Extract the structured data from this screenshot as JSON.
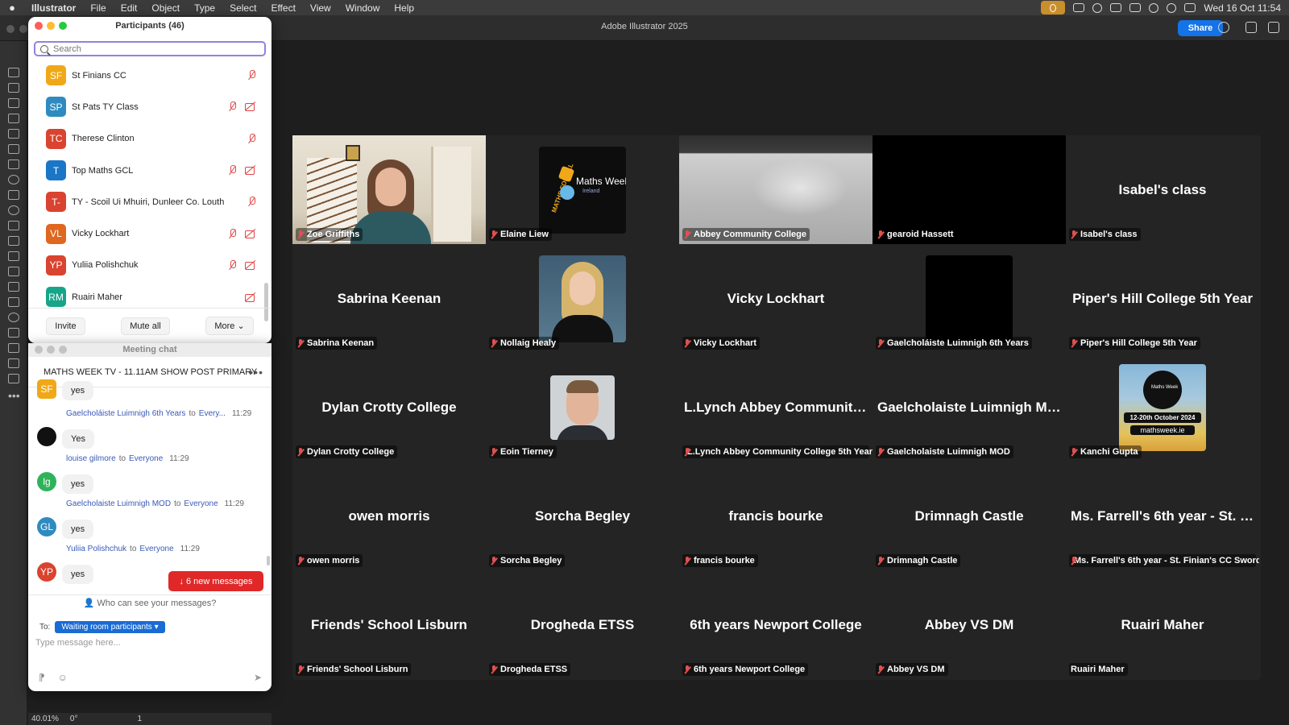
{
  "menubar": {
    "app": "Illustrator",
    "items": [
      "File",
      "Edit",
      "Object",
      "Type",
      "Select",
      "Effect",
      "View",
      "Window",
      "Help"
    ],
    "datetime": "Wed 16 Oct  11:54"
  },
  "app_window": {
    "title": "Adobe Illustrator 2025",
    "share": "Share"
  },
  "statusbar": {
    "zoom": "40.01%",
    "rotation": "0°",
    "artboard": "1"
  },
  "participants": {
    "title": "Participants (46)",
    "search_placeholder": "Search",
    "rows": [
      {
        "initials": "SF",
        "name": "St Finians CC",
        "color": "#f0a818",
        "mic_muted": true,
        "cam_off": false
      },
      {
        "initials": "SP",
        "name": "St Pats TY Class",
        "color": "#2e8bc0",
        "mic_muted": true,
        "cam_off": true
      },
      {
        "initials": "TC",
        "name": "Therese Clinton",
        "color": "#d9432f",
        "mic_muted": true,
        "cam_off": false
      },
      {
        "initials": "T",
        "name": "Top Maths GCL",
        "color": "#1a76c6",
        "mic_muted": true,
        "cam_off": true
      },
      {
        "initials": "T-",
        "name": "TY - Scoil Ui Mhuiri, Dunleer Co. Louth",
        "color": "#d9432f",
        "mic_muted": true,
        "cam_off": false
      },
      {
        "initials": "VL",
        "name": "Vicky Lockhart",
        "color": "#e0671f",
        "mic_muted": true,
        "cam_off": true
      },
      {
        "initials": "YP",
        "name": "Yuliia Polishchuk",
        "color": "#d9432f",
        "mic_muted": true,
        "cam_off": true
      },
      {
        "initials": "RM",
        "name": "Ruairi Maher",
        "color": "#17a589",
        "mic_muted": false,
        "cam_off": true
      }
    ],
    "footer": {
      "invite": "Invite",
      "mute_all": "Mute all",
      "more": "More"
    }
  },
  "chat": {
    "window_title": "Meeting chat",
    "header": "MATHS WEEK TV - 11.11AM SHOW POST PRIMARY",
    "messages": [
      {
        "initials": "SF",
        "color": "#f0a818",
        "sender": "",
        "to": "",
        "time": "",
        "text": "yes"
      },
      {
        "initials": "",
        "color": "#111111",
        "sender": "Gaelcholáiste Luimnigh 6th Years",
        "to": "Every...",
        "time": "11:29",
        "text": "Yes"
      },
      {
        "initials": "lg",
        "color": "#2fb35a",
        "sender": "louise gilmore",
        "to": "Everyone",
        "time": "11:29",
        "text": "yes"
      },
      {
        "initials": "GL",
        "color": "#2e8bc0",
        "sender": "Gaelcholaiste Luimnigh MOD",
        "to": "Everyone",
        "time": "11:29",
        "text": "yes"
      },
      {
        "initials": "YP",
        "color": "#d9432f",
        "sender": "Yuliia Polishchuk",
        "to": "Everyone",
        "time": "11:29",
        "text": "yes"
      }
    ],
    "to_word": "to",
    "new_messages": "↓ 6 new messages",
    "who_can_see": "Who can see your messages?",
    "to_label": "To:",
    "recipient": "Waiting room participants",
    "input_placeholder": "Type message here..."
  },
  "grid": {
    "tiles": [
      {
        "label": "Zoe Griffiths",
        "big": "",
        "kind": "video",
        "active": true
      },
      {
        "label": "Elaine Liew",
        "big": "",
        "kind": "mathsweek"
      },
      {
        "label": "Abbey Community College",
        "big": "",
        "kind": "classroom"
      },
      {
        "label": "gearoid Hassett",
        "big": "",
        "kind": "black"
      },
      {
        "label": "Isabel's class",
        "big": "Isabel's class",
        "kind": "name"
      },
      {
        "label": "Sabrina Keenan",
        "big": "Sabrina Keenan",
        "kind": "name"
      },
      {
        "label": "Nollaig Healy",
        "big": "",
        "kind": "portrait-woman"
      },
      {
        "label": "Vicky Lockhart",
        "big": "Vicky Lockhart",
        "kind": "name"
      },
      {
        "label": "Gaelcholáiste Luimnigh 6th Years",
        "big": "",
        "kind": "black-square"
      },
      {
        "label": "Piper's Hill College 5th Year",
        "big": "Piper's Hill College 5th Year",
        "kind": "name"
      },
      {
        "label": "Dylan Crotty College",
        "big": "Dylan Crotty College",
        "kind": "name"
      },
      {
        "label": "Eoin Tierney",
        "big": "",
        "kind": "portrait-man"
      },
      {
        "label": "L.Lynch Abbey Community College 5th Year",
        "big": "L.Lynch Abbey Community...",
        "kind": "name"
      },
      {
        "label": "Gaelcholaiste Luimnigh MOD",
        "big": "Gaelcholaiste Luimnigh MOD",
        "kind": "name"
      },
      {
        "label": "Kanchi Gupta",
        "big": "",
        "kind": "poster"
      },
      {
        "label": "owen morris",
        "big": "owen morris",
        "kind": "name"
      },
      {
        "label": "Sorcha Begley",
        "big": "Sorcha Begley",
        "kind": "name"
      },
      {
        "label": "francis bourke",
        "big": "francis bourke",
        "kind": "name"
      },
      {
        "label": "Drimnagh Castle",
        "big": "Drimnagh Castle",
        "kind": "name"
      },
      {
        "label": "Ms. Farrell's 6th year - St. Finian's CC Swords",
        "big": "Ms. Farrell's 6th year - St. Fi...",
        "kind": "name"
      },
      {
        "label": "Friends' School Lisburn",
        "big": "Friends' School Lisburn",
        "kind": "name"
      },
      {
        "label": "Drogheda ETSS",
        "big": "Drogheda ETSS",
        "kind": "name"
      },
      {
        "label": "6th years Newport College",
        "big": "6th years Newport College",
        "kind": "name"
      },
      {
        "label": "Abbey VS DM",
        "big": "Abbey VS DM",
        "kind": "name"
      },
      {
        "label": "Ruairi Maher",
        "big": "Ruairi Maher",
        "kind": "name",
        "unmuted": true
      }
    ],
    "mathsweek_logo": {
      "arc": "MATHS FOR ALL",
      "title": "Maths Week",
      "sub": "Ireland"
    },
    "poster": {
      "dates": "12-20th October 2024",
      "site": "mathsweek.ie",
      "title": "Maths Week"
    }
  },
  "colors": {
    "accent": "#1473e6",
    "active_speaker": "#25b84a",
    "muted": "#e05050",
    "new_msgs": "#e02828"
  }
}
